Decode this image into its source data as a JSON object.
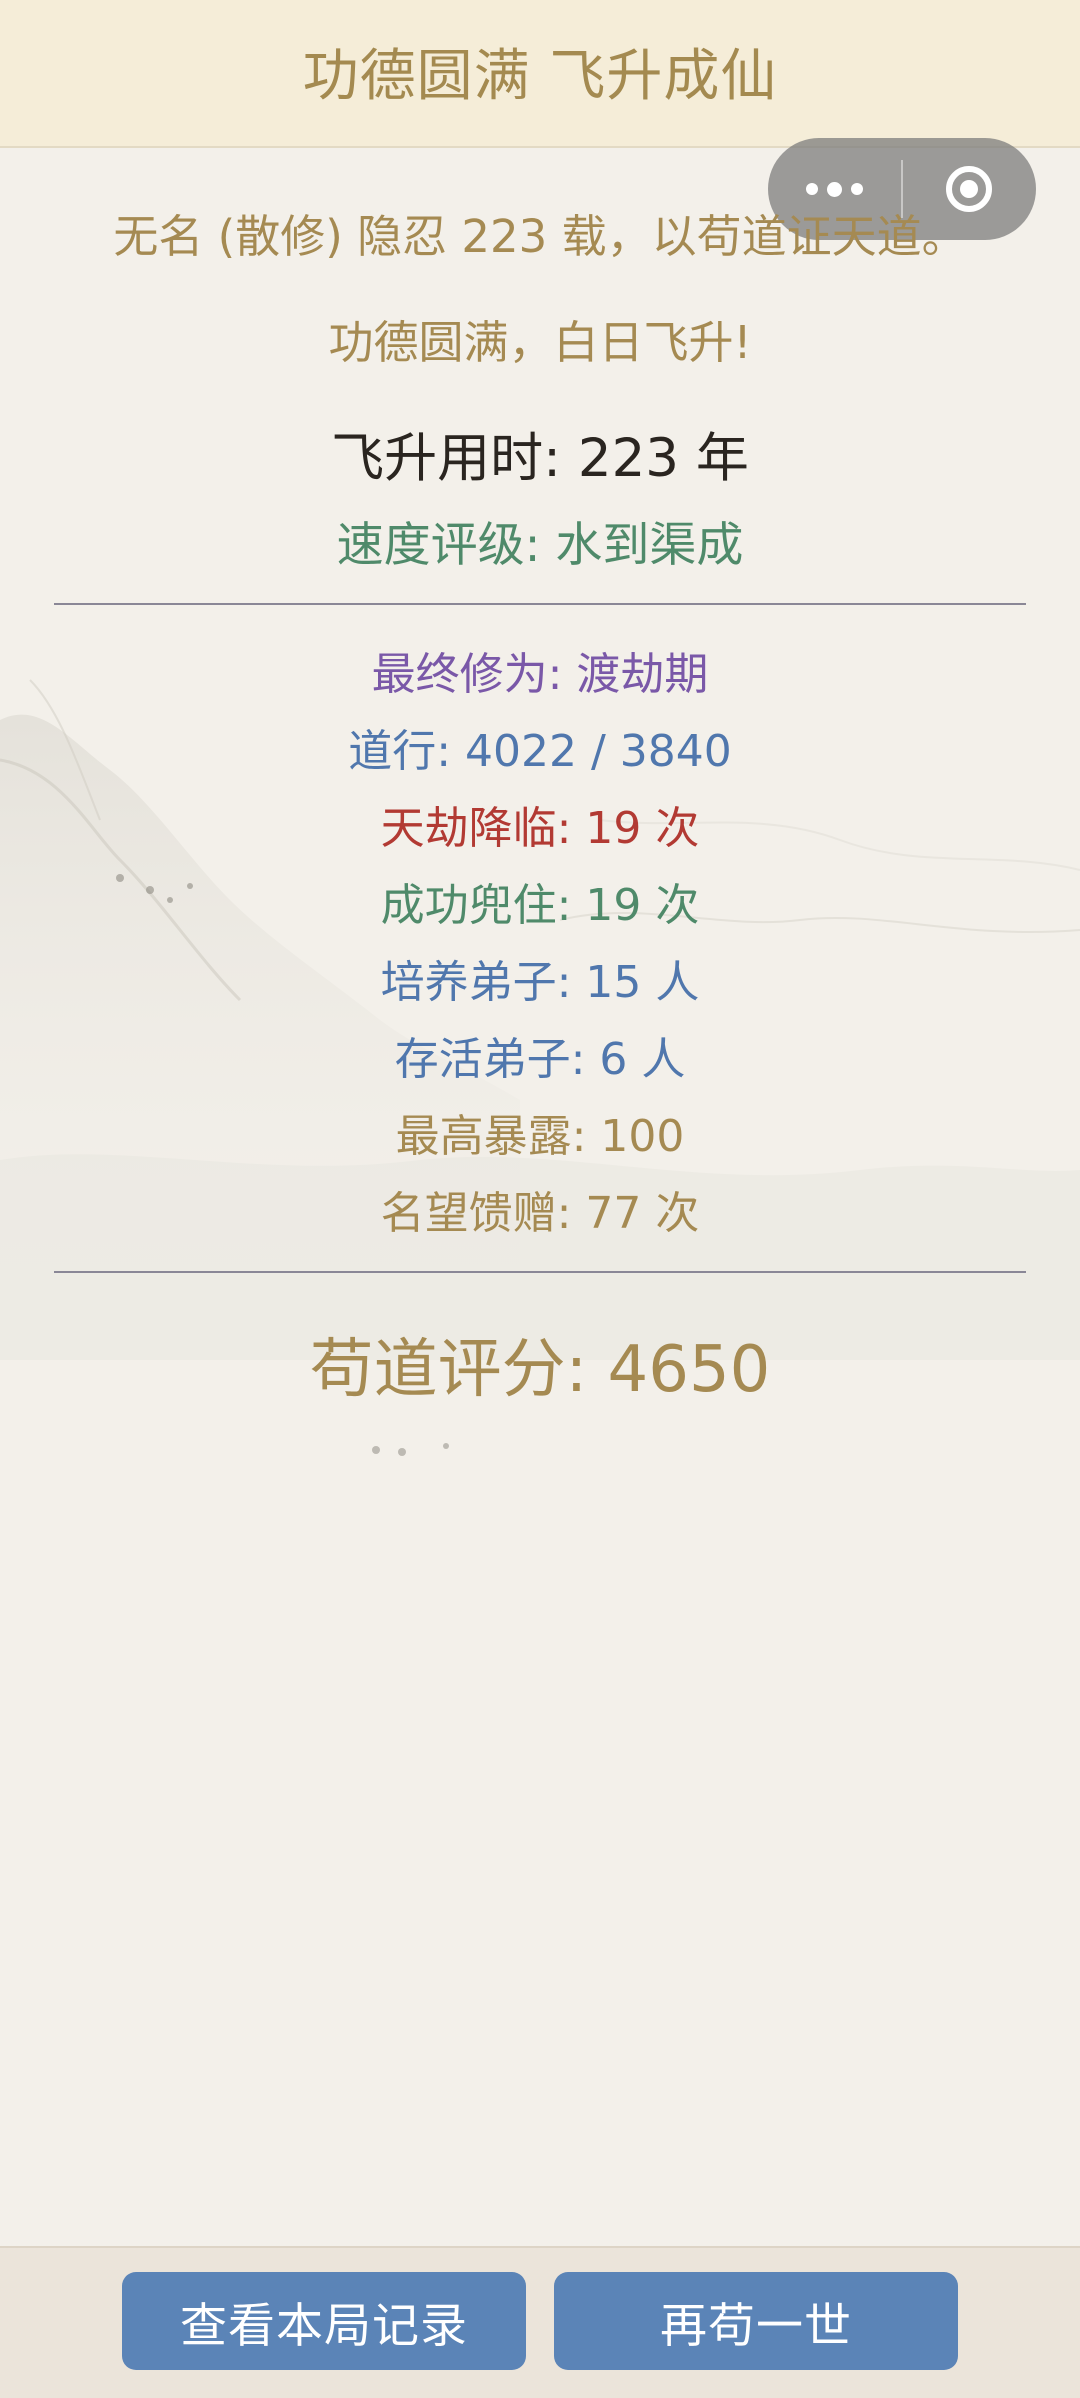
{
  "header": {
    "title": "功德圆满 飞升成仙"
  },
  "capsule": {
    "more_icon": "more-dots-icon",
    "close_icon": "target-close-icon"
  },
  "result": {
    "intro": "无名 (散修) 隐忍 223 载，以苟道证天道。",
    "ascension": "功德圆满，白日飞升!",
    "time_used": "飞升用时: 223 年",
    "speed_rating": "速度评级: 水到渠成"
  },
  "stats": [
    {
      "text": "最终修为: 渡劫期",
      "color": "#7a58a8"
    },
    {
      "text": "道行: 4022 / 3840",
      "color": "#5077ad"
    },
    {
      "text": "天劫降临: 19 次",
      "color": "#b23a33"
    },
    {
      "text": "成功兜住: 19 次",
      "color": "#4f8a6a"
    },
    {
      "text": "培养弟子: 15 人",
      "color": "#5077ad"
    },
    {
      "text": "存活弟子: 6 人",
      "color": "#5077ad"
    },
    {
      "text": "最高暴露: 100",
      "color": "#a58a52"
    },
    {
      "text": "名望馈赠: 77 次",
      "color": "#a58a52"
    }
  ],
  "score": "苟道评分: 4650",
  "buttons": {
    "view_record": "查看本局记录",
    "play_again": "再苟一世"
  },
  "colors": {
    "header_bg": "#f5edd8",
    "gold_text": "#a58a52",
    "button_blue": "#5b84b7",
    "page_bg": "#f3f0ea"
  }
}
